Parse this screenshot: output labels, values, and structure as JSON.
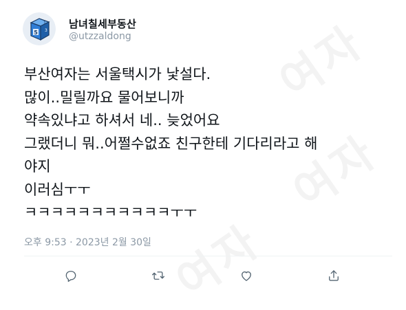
{
  "user": {
    "display_name": "남녀칠세부동산",
    "handle": "@utzzaldong",
    "avatar_icon": "blue-cube-avatar-icon"
  },
  "tweet": {
    "text": "부산여자는 서울택시가 낯설다.\n많이..밀릴까요 물어보니까\n약속있냐고 하셔서 네.. 늦었어요\n그랬더니 뭐..어쩔수없죠 친구한테 기다리라고 해\n야지\n이러심ㅜㅜ\nㅋㅋㅋㅋㅋㅋㅋㅋㅋㅋㅋㅜㅜ",
    "timestamp": "오후 9:53 · 2023년 2월 30일"
  },
  "actions": [
    {
      "name": "reply",
      "icon": "reply-icon"
    },
    {
      "name": "retweet",
      "icon": "retweet-icon"
    },
    {
      "name": "like",
      "icon": "heart-icon"
    },
    {
      "name": "share",
      "icon": "share-icon"
    }
  ],
  "watermark": "여자",
  "colors": {
    "text": "#0f1419",
    "secondary": "#8b98a5",
    "avatar_blue": "#2e7dd7"
  }
}
